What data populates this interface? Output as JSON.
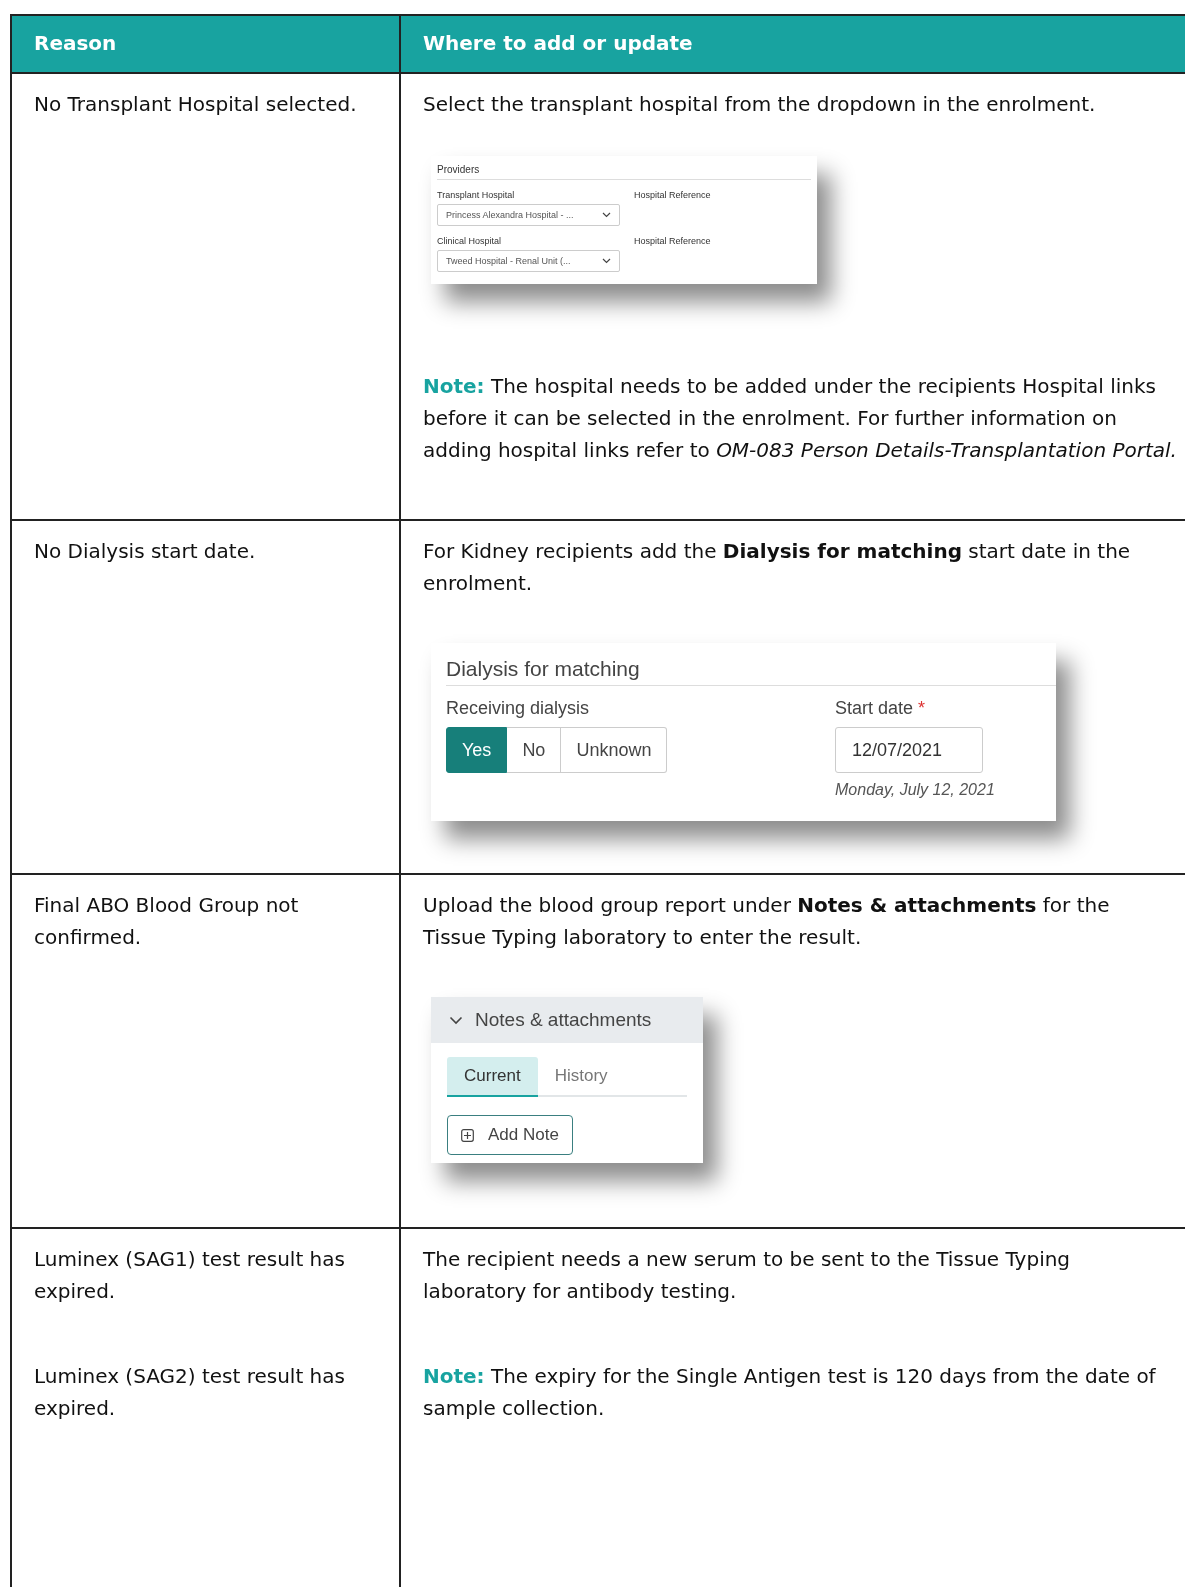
{
  "table": {
    "columns": [
      "Reason",
      "Where to add or update"
    ],
    "rows": [
      {
        "reasons": [
          "No Transplant Hospital selected."
        ],
        "details": [
          {
            "kind": "text",
            "text": "Select the transplant hospital from the dropdown in the enrolment."
          },
          {
            "kind": "providers",
            "title": "Providers",
            "fields": [
              {
                "label": "Transplant Hospital",
                "value": "Princess Alexandra Hospital - ...",
                "ref_label": "Hospital Reference"
              },
              {
                "label": "Clinical Hospital",
                "value": "Tweed Hospital - Renal Unit (...",
                "ref_label": "Hospital Reference"
              }
            ]
          },
          {
            "kind": "note",
            "label": "Note:",
            "text": "The hospital needs to be added under the recipients Hospital links before it can be selected in the enrolment. For further information on adding hospital links refer to *OM-083 Person Details-Transplantation Portal.*"
          }
        ]
      },
      {
        "reasons": [
          "No Dialysis start date."
        ],
        "details": [
          {
            "kind": "text",
            "text": "For Kidney recipients add the **Dialysis for matching** start date in the enrolment."
          },
          {
            "kind": "dialysis",
            "title": "Dialysis for matching",
            "label": "Receiving dialysis",
            "options": [
              {
                "label": "Yes",
                "selected": true
              },
              {
                "label": "No",
                "selected": false
              },
              {
                "label": "Unknown",
                "selected": false
              }
            ],
            "date_label": "Start date",
            "required_mark": "*",
            "date": "12/07/2021",
            "date_hint": "Monday, July 12, 2021"
          }
        ]
      },
      {
        "reasons": [
          "Final ABO Blood Group not confirmed."
        ],
        "details": [
          {
            "kind": "text",
            "text": "Upload the blood group report under **Notes & attachments** for the Tissue Typing laboratory to enter the result."
          },
          {
            "kind": "notes_panel",
            "title": "Notes & attachments",
            "expanded": true,
            "tabs": [
              {
                "label": "Current",
                "selected": true
              },
              {
                "label": "History",
                "selected": false
              }
            ],
            "button": "Add Note"
          }
        ]
      },
      {
        "reasons": [
          "Luminex (SAG1) test result has expired.",
          "Luminex (SAG2) test result has expired."
        ],
        "details": [
          {
            "kind": "text",
            "text": "The recipient needs a new serum to be sent to the Tissue Typing laboratory for antibody testing."
          },
          {
            "kind": "note",
            "label": "Note:",
            "text": "The expiry for the Single Antigen test is 120 days from the date of sample collection."
          }
        ]
      }
    ]
  }
}
